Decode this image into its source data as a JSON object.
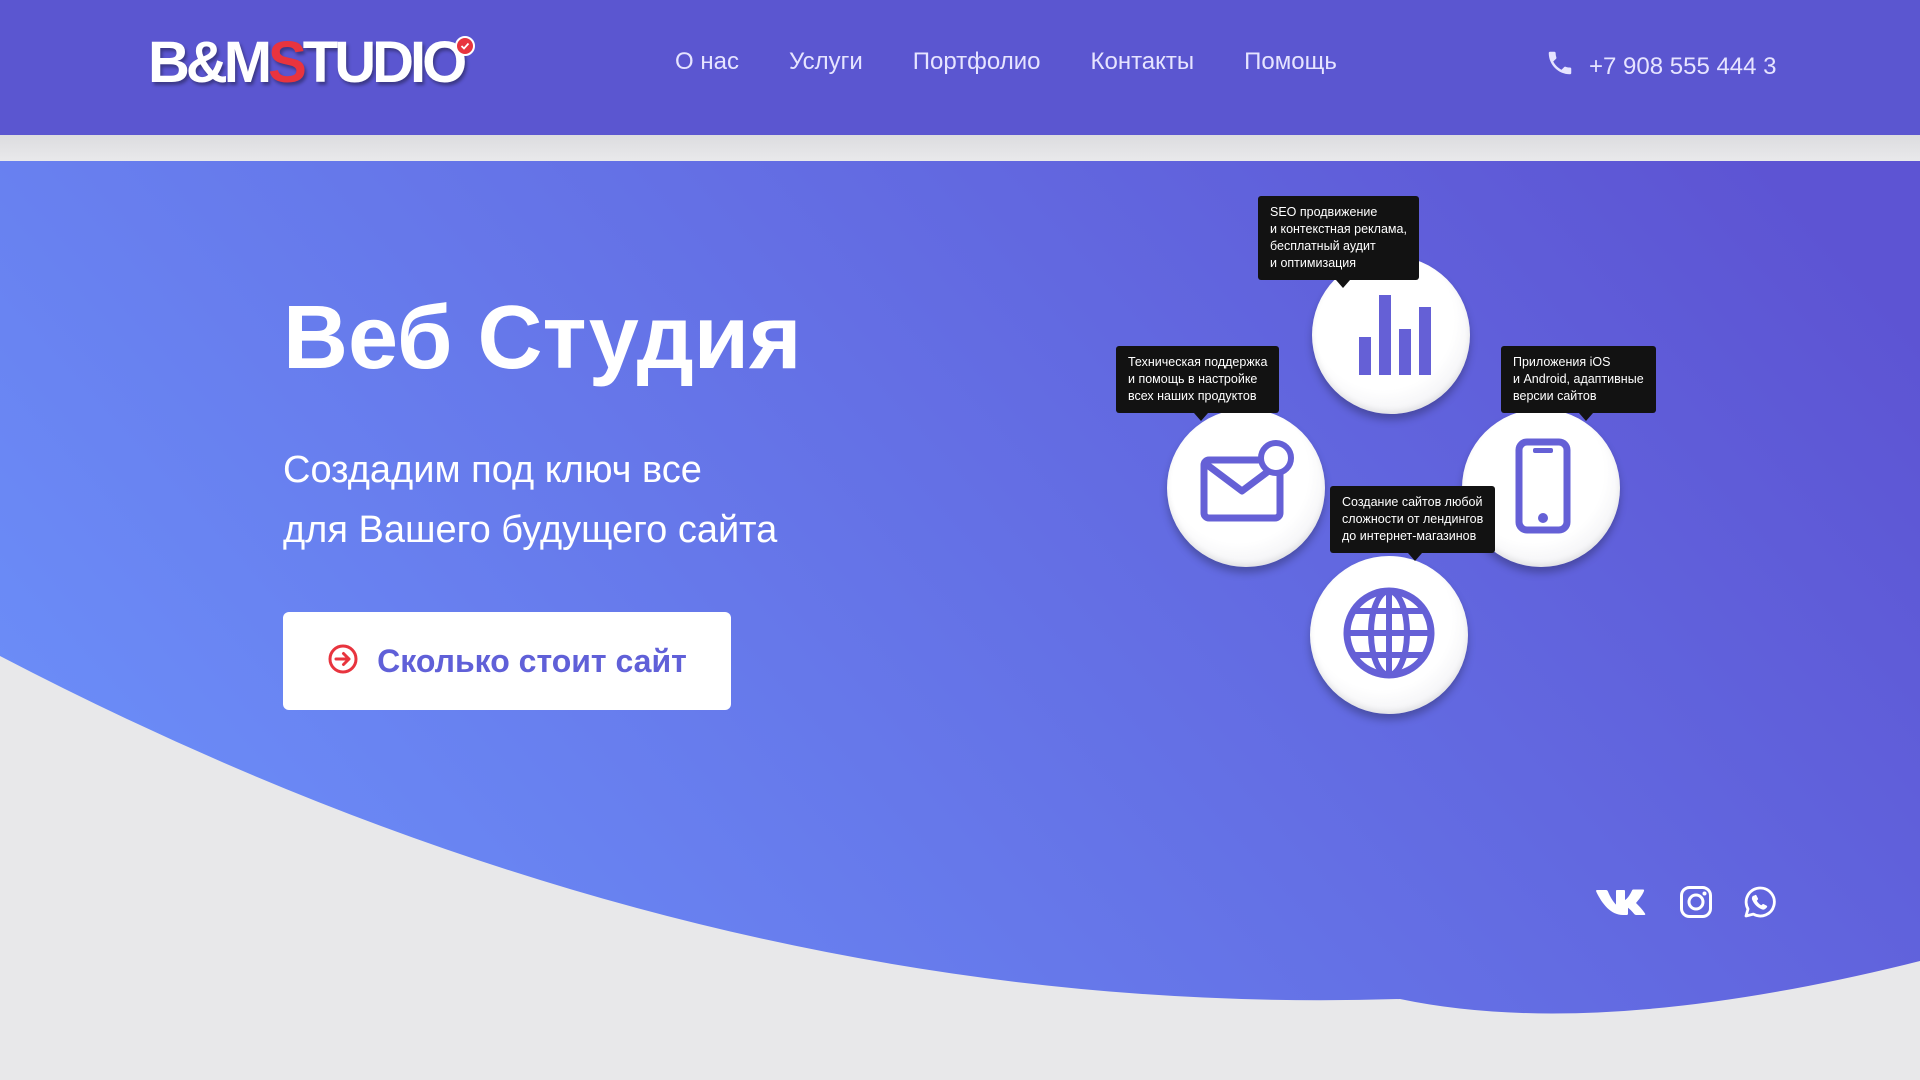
{
  "brand": {
    "logo_main": "B&M",
    "logo_accent": "S",
    "logo_rest": "TUDIO"
  },
  "nav": {
    "items": [
      {
        "label": "О нас"
      },
      {
        "label": "Услуги"
      },
      {
        "label": "Портфолио"
      },
      {
        "label": "Контакты"
      },
      {
        "label": "Помощь"
      }
    ]
  },
  "contact": {
    "phone_icon": "phone-icon",
    "phone": "+7 908 555 444 3"
  },
  "hero": {
    "title": "Веб Студия",
    "subtitle_line1": "Создадим под ключ все",
    "subtitle_line2": "для Вашего будущего сайта",
    "cta_label": "Сколько стоит сайт",
    "cta_icon": "arrow-circle-right-icon"
  },
  "services": {
    "seo": {
      "icon": "bar-chart-icon",
      "tooltip": [
        "SEO продвижение",
        "и контекстная реклама,",
        "бесплатный аудит",
        "и оптимизация"
      ]
    },
    "support": {
      "icon": "mail-notification-icon",
      "tooltip": [
        "Техническая поддержка",
        "и помощь в настройке",
        "всех наших продуктов"
      ]
    },
    "apps": {
      "icon": "smartphone-icon",
      "tooltip": [
        "Приложения iOS",
        "и Android, адаптивные",
        "версии сайтов"
      ]
    },
    "web": {
      "icon": "globe-icon",
      "tooltip": [
        "Создание сайтов любой",
        "сложности от лендингов",
        "до интернет-магазинов"
      ]
    }
  },
  "social": [
    "vk-icon",
    "instagram-icon",
    "whatsapp-icon"
  ],
  "colors": {
    "header_bg": "#5b56d0",
    "hero_gradient_start": "#6b8cf7",
    "hero_gradient_end": "#5e55d4",
    "accent_red": "#e8343e",
    "icon_purple": "#6560d6",
    "page_bg": "#e8e8ea"
  }
}
